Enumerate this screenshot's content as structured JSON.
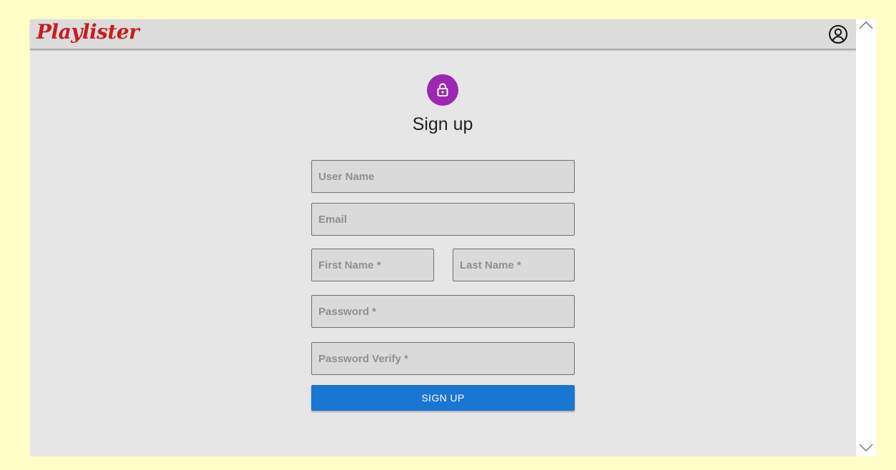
{
  "app": {
    "logo_text": "Playlister"
  },
  "form": {
    "title": "Sign up",
    "fields": {
      "username": {
        "placeholder": "User Name"
      },
      "email": {
        "placeholder": "Email"
      },
      "first_name": {
        "placeholder": "First Name *"
      },
      "last_name": {
        "placeholder": "Last Name *"
      },
      "password": {
        "placeholder": "Password *"
      },
      "password_verify": {
        "placeholder": "Password Verify *"
      }
    },
    "submit_label": "SIGN UP"
  },
  "icons": {
    "account": "account-circle-icon",
    "lock": "lock-icon",
    "scroll_up": "chevron-up-icon",
    "scroll_down": "chevron-down-icon"
  },
  "colors": {
    "page_background": "#fffdc8",
    "app_background": "#e6e6e6",
    "appbar_background": "#dcdcdc",
    "logo": "#c81d1d",
    "lock_avatar": "#9c27b0",
    "primary_button": "#1976d2",
    "field_background": "#dadada"
  }
}
